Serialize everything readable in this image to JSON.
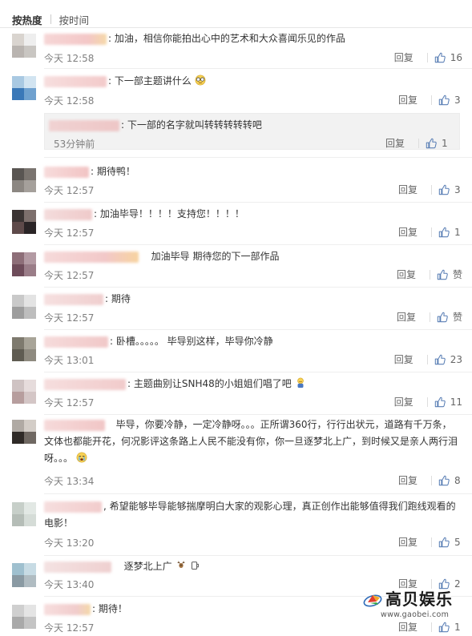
{
  "sort": {
    "hot": "按热度",
    "time": "按时间"
  },
  "labels": {
    "reply": "回复"
  },
  "icons": {
    "like": "thumbs-up-icon"
  },
  "comments": [
    {
      "text": "加油，相信你能拍出心中的艺术和大众喜闻乐见的作品",
      "time": "今天 12:58",
      "likes": "16"
    },
    {
      "text": "下一部主题讲什么",
      "time": "今天 12:58",
      "likes": "3",
      "sub": {
        "text": "下一部的名字就叫转转转转转吧",
        "time": "53分钟前",
        "likes": "1"
      }
    },
    {
      "text": "期待鸭！",
      "time": "今天 12:57",
      "likes": "3"
    },
    {
      "text": "加油毕导！！！！支持您！！！！",
      "time": "今天 12:57",
      "likes": "1"
    },
    {
      "text": "加油毕导 期待您的下一部作品",
      "time": "今天 12:57",
      "likes": "赞"
    },
    {
      "text": "期待",
      "time": "今天 12:57",
      "likes": "赞"
    },
    {
      "text": "卧槽。。。。。 毕导别这样，毕导你冷静",
      "time": "今天 13:01",
      "likes": "23"
    },
    {
      "text": "主题曲别让SNH48的小姐姐们唱了吧",
      "time": "今天 12:57",
      "likes": "11"
    },
    {
      "text1": "毕导，你要冷静，一定冷静呀。。。正所谓360行，行行出状元，道路有千万条，",
      "text2": "文体也都能开花，何况影评这条路上人民不能没有你，你一旦逐梦北上广，到时候又是亲人两行泪",
      "text3": "呀。。。",
      "time": "今天 13:34",
      "likes": "8"
    },
    {
      "text1": "希望能够毕导能够揣摩明白大家的观影心理，真正创作出能够值得我们跑线观看的",
      "text2": "电影！",
      "time": "今天 13:20",
      "likes": "5"
    },
    {
      "text": "逐梦北上广",
      "time": "今天 13:40",
      "likes": "2"
    },
    {
      "text": "期待！",
      "time": "今天 12:57",
      "likes": "1"
    }
  ],
  "watermark": {
    "title": "高贝娱乐",
    "url": "www.gaobei.com"
  },
  "colors": {
    "accent": "#eb7350",
    "like": "#5a7fb5",
    "muted": "#808080"
  }
}
